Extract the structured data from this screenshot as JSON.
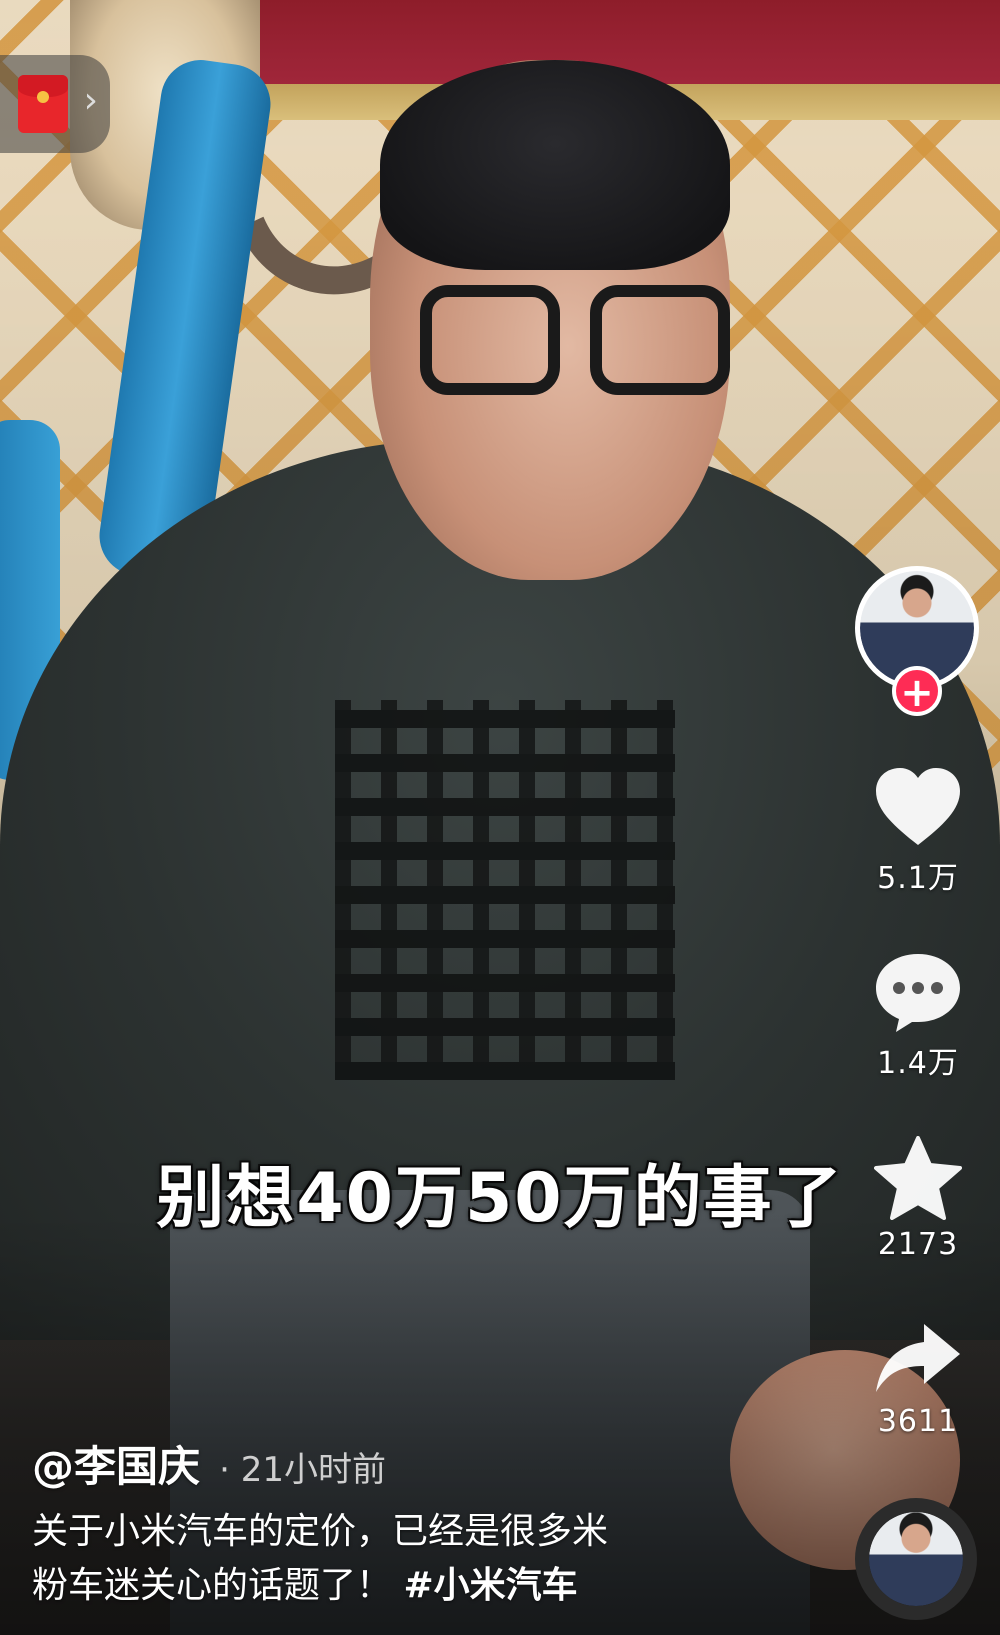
{
  "overlay": {
    "caption": "别想40万50万的事了"
  },
  "red_packet": {
    "icon": "red-envelope-icon",
    "arrow": "›"
  },
  "actions": {
    "follow_label": "+",
    "likes": "5.1万",
    "comments": "1.4万",
    "favorites": "2173",
    "shares": "3611"
  },
  "author": {
    "handle": "@李国庆",
    "separator": "·",
    "time_ago": "21小时前"
  },
  "description": {
    "line1": "关于小米汽车的定价，已经是很多米",
    "line2": "粉车迷关心的话题了！",
    "hashtag": "#小米汽车"
  },
  "colors": {
    "follow_red": "#fe2c55",
    "envelope_red": "#e8262b",
    "text_white": "#ffffff"
  }
}
